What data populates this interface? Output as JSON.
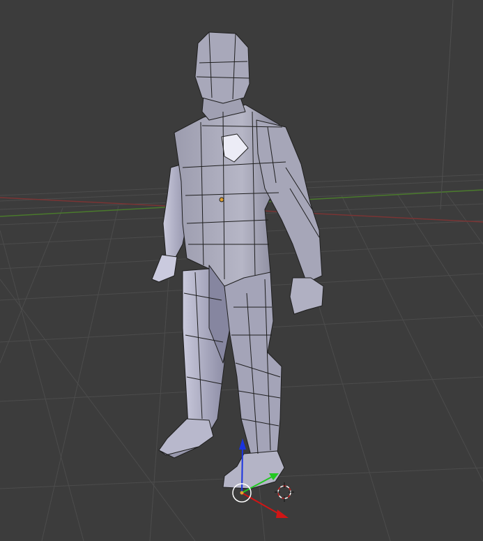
{
  "viewport": {
    "background": "#3c3c3c",
    "grid_color": "#4a4a4a",
    "x_axis_color": "#8a3a3a",
    "y_axis_color": "#4f8a2f",
    "object_name_icon": "humanoid-mesh",
    "mesh_face_color": "#9a9ab0",
    "mesh_edge_color": "#202020",
    "origin_color": "#e0a030",
    "gizmo": {
      "x_color": "#d01515",
      "y_color": "#22c822",
      "z_color": "#1a33e0",
      "center_ring_color": "#ffffff"
    },
    "cursor_icon": "3d-cursor-icon",
    "cursor_colors": [
      "#d02020",
      "#ffffff"
    ]
  }
}
